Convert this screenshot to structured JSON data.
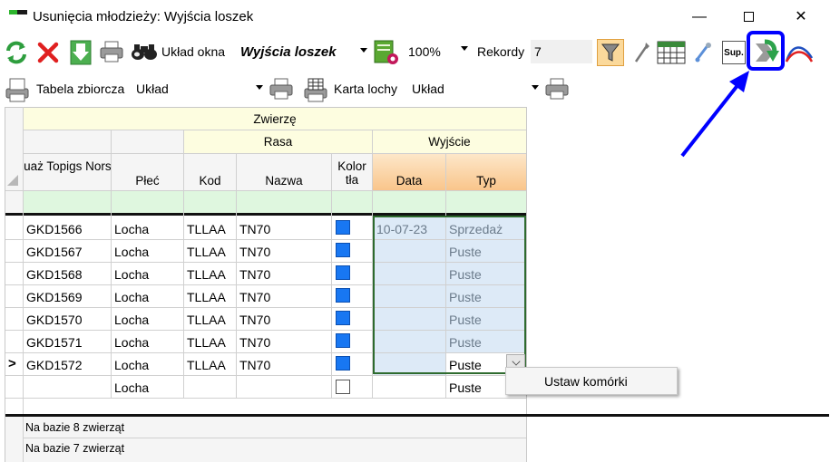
{
  "window": {
    "title": "Usunięcia młodzieży: Wyjścia loszek",
    "minimize": "—",
    "close": "✕"
  },
  "toolbar1": {
    "uklad_label": "Układ okna",
    "uklad_value": "Wyjścia loszek",
    "zoom_value": "100%",
    "rekordy_label": "Rekordy",
    "rekordy_value": "7",
    "sup_label": "Sup."
  },
  "toolbar2": {
    "tabela_label": "Tabela zbiorcza",
    "tabela_value": "Układ",
    "karta_label": "Karta lochy",
    "karta_value": "Układ"
  },
  "grid": {
    "group_header": "Zwierzę",
    "subgroup_rasa": "Rasa",
    "subgroup_wyjscie": "Wyjście",
    "columns": {
      "tatuaz": "Tatuaż Topigs Norsvin",
      "plec": "Płeć",
      "kod": "Kod",
      "nazwa": "Nazwa",
      "kolor": "Kolor tła",
      "data": "Data",
      "typ": "Typ"
    },
    "rows": [
      {
        "tatuaz": "GKD1566",
        "plec": "Locha",
        "kod": "TLLAA",
        "nazwa": "TN70",
        "data": "10-07-23",
        "typ": "Sprzedaż"
      },
      {
        "tatuaz": "GKD1567",
        "plec": "Locha",
        "kod": "TLLAA",
        "nazwa": "TN70",
        "data": "",
        "typ": "Puste"
      },
      {
        "tatuaz": "GKD1568",
        "plec": "Locha",
        "kod": "TLLAA",
        "nazwa": "TN70",
        "data": "",
        "typ": "Puste"
      },
      {
        "tatuaz": "GKD1569",
        "plec": "Locha",
        "kod": "TLLAA",
        "nazwa": "TN70",
        "data": "",
        "typ": "Puste"
      },
      {
        "tatuaz": "GKD1570",
        "plec": "Locha",
        "kod": "TLLAA",
        "nazwa": "TN70",
        "data": "",
        "typ": "Puste"
      },
      {
        "tatuaz": "GKD1571",
        "plec": "Locha",
        "kod": "TLLAA",
        "nazwa": "TN70",
        "data": "",
        "typ": "Puste"
      },
      {
        "tatuaz": "GKD1572",
        "plec": "Locha",
        "kod": "TLLAA",
        "nazwa": "TN70",
        "data": "",
        "typ": "Puste"
      }
    ],
    "new_row": {
      "plec": "Locha",
      "typ": "Puste"
    },
    "current_row_marker": ">",
    "footer": [
      "Na bazie 8 zwierząt",
      "Na bazie 7 zwierząt"
    ]
  },
  "context_menu": {
    "item": "Ustaw komórki"
  },
  "colors": {
    "accent_blue": "#0000ff",
    "cell_color": "#1877f2",
    "frame_green": "#2e6b2e"
  }
}
